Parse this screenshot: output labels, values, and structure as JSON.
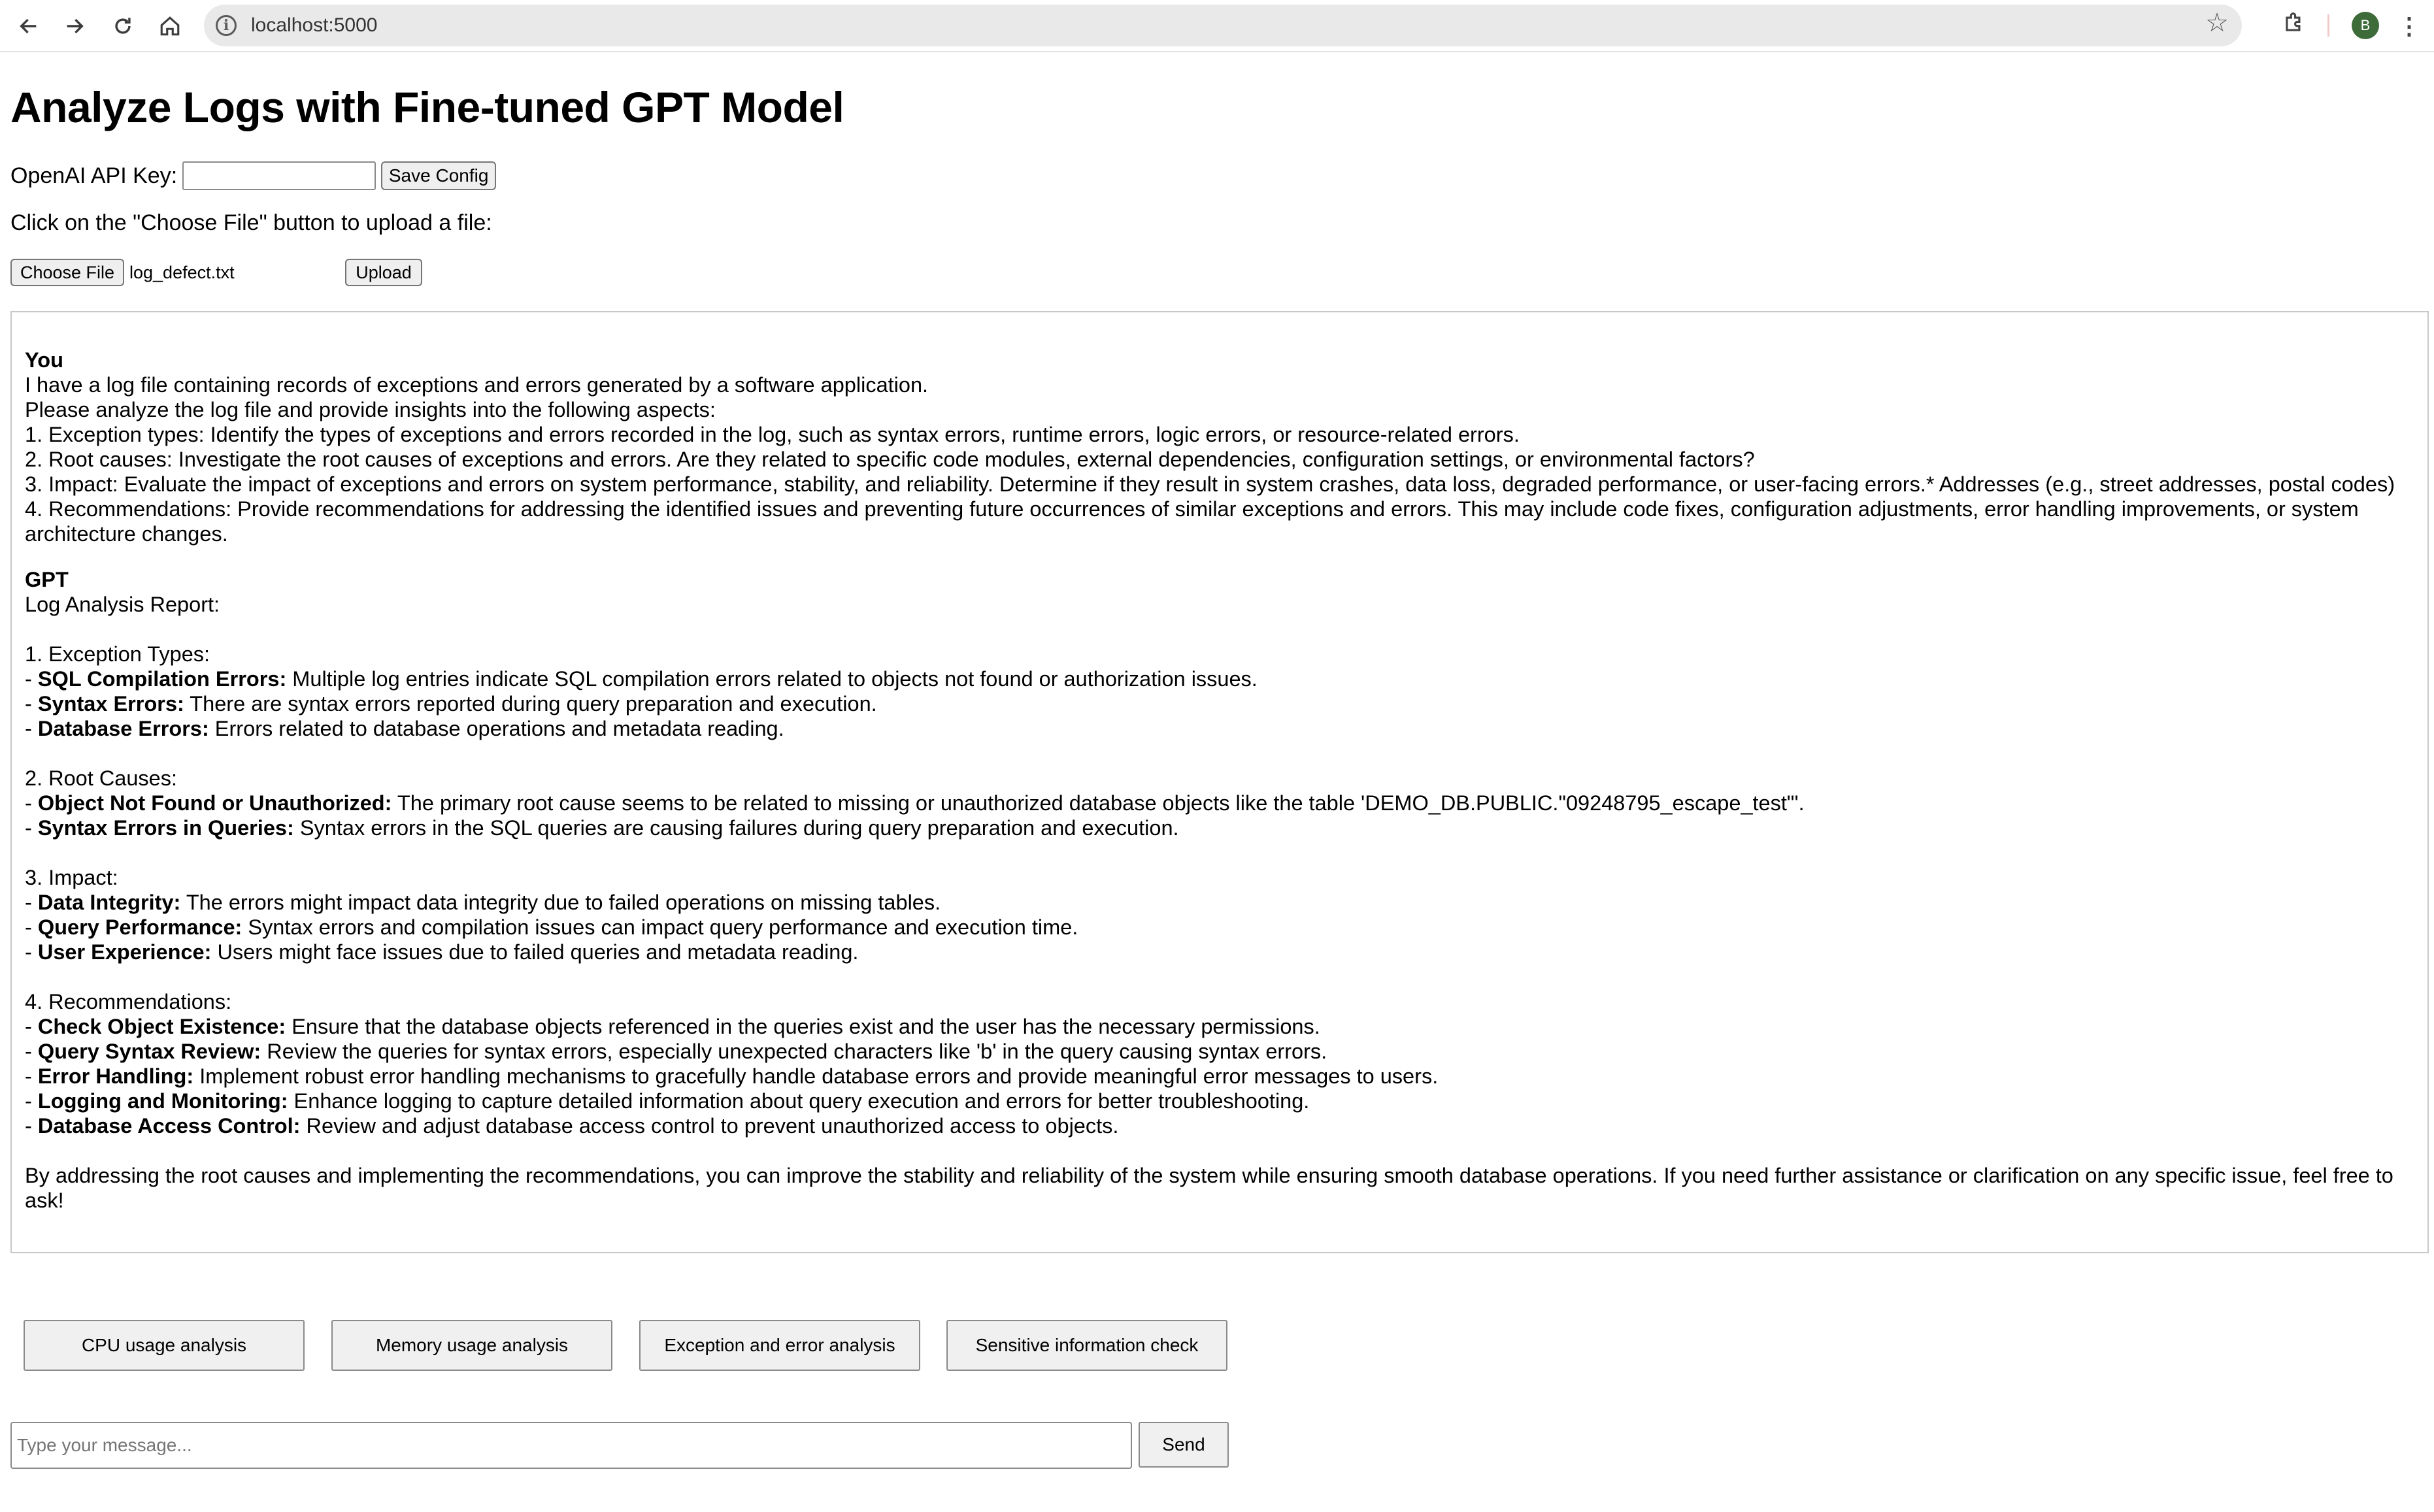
{
  "browser": {
    "url": "localhost:5000",
    "avatar_letter": "B",
    "icons": [
      "back-arrow-icon",
      "forward-arrow-icon",
      "reload-icon",
      "home-icon",
      "site-info-icon",
      "bookmark-star-icon",
      "extensions-puzzle-icon",
      "kebab-menu-icon"
    ]
  },
  "page": {
    "title": "Analyze Logs with Fine-tuned GPT Model",
    "api_key_label": "OpenAI API Key:",
    "api_key_value": "",
    "save_config_label": "Save Config",
    "upload_hint": "Click on the \"Choose File\" button to upload a file:",
    "choose_file_label": "Choose File",
    "file_name": "log_defect.txt",
    "upload_label": "Upload"
  },
  "chat": {
    "user": {
      "sender": "You",
      "lines": [
        "I have a log file containing records of exceptions and errors generated by a software application.",
        "Please analyze the log file and provide insights into the following aspects:",
        "1. Exception types: Identify the types of exceptions and errors recorded in the log, such as syntax errors, runtime errors, logic errors, or resource-related errors.",
        "2. Root causes: Investigate the root causes of exceptions and errors. Are they related to specific code modules, external dependencies, configuration settings, or environmental factors?",
        "3. Impact: Evaluate the impact of exceptions and errors on system performance, stability, and reliability. Determine if they result in system crashes, data loss, degraded performance, or user-facing errors.* Addresses (e.g., street addresses, postal codes)",
        "4. Recommendations: Provide recommendations for addressing the identified issues and preventing future occurrences of similar exceptions and errors. This may include code fixes, configuration adjustments, error handling improvements, or system architecture changes."
      ]
    },
    "gpt": {
      "sender": "GPT",
      "lines": [
        {
          "b": "",
          "t": "Log Analysis Report:"
        },
        {
          "b": "",
          "t": ""
        },
        {
          "b": "",
          "t": "1. Exception Types:"
        },
        {
          "b": "SQL Compilation Errors:",
          "t": " Multiple log entries indicate SQL compilation errors related to objects not found or authorization issues.",
          "p": "- "
        },
        {
          "b": "Syntax Errors:",
          "t": " There are syntax errors reported during query preparation and execution.",
          "p": "- "
        },
        {
          "b": "Database Errors:",
          "t": " Errors related to database operations and metadata reading.",
          "p": "- "
        },
        {
          "b": "",
          "t": ""
        },
        {
          "b": "",
          "t": "2. Root Causes:"
        },
        {
          "b": "Object Not Found or Unauthorized:",
          "t": " The primary root cause seems to be related to missing or unauthorized database objects like the table 'DEMO_DB.PUBLIC.\"09248795_escape_test\"'.",
          "p": "- "
        },
        {
          "b": "Syntax Errors in Queries:",
          "t": " Syntax errors in the SQL queries are causing failures during query preparation and execution.",
          "p": "- "
        },
        {
          "b": "",
          "t": ""
        },
        {
          "b": "",
          "t": "3. Impact:"
        },
        {
          "b": "Data Integrity:",
          "t": " The errors might impact data integrity due to failed operations on missing tables.",
          "p": "- "
        },
        {
          "b": "Query Performance:",
          "t": " Syntax errors and compilation issues can impact query performance and execution time.",
          "p": "- "
        },
        {
          "b": "User Experience:",
          "t": " Users might face issues due to failed queries and metadata reading.",
          "p": "- "
        },
        {
          "b": "",
          "t": ""
        },
        {
          "b": "",
          "t": "4. Recommendations:"
        },
        {
          "b": "Check Object Existence:",
          "t": " Ensure that the database objects referenced in the queries exist and the user has the necessary permissions.",
          "p": "- "
        },
        {
          "b": "Query Syntax Review:",
          "t": " Review the queries for syntax errors, especially unexpected characters like 'b' in the query causing syntax errors.",
          "p": "- "
        },
        {
          "b": "Error Handling:",
          "t": " Implement robust error handling mechanisms to gracefully handle database errors and provide meaningful error messages to users.",
          "p": "- "
        },
        {
          "b": "Logging and Monitoring:",
          "t": " Enhance logging to capture detailed information about query execution and errors for better troubleshooting.",
          "p": "- "
        },
        {
          "b": "Database Access Control:",
          "t": " Review and adjust database access control to prevent unauthorized access to objects.",
          "p": "- "
        },
        {
          "b": "",
          "t": ""
        },
        {
          "b": "",
          "t": "By addressing the root causes and implementing the recommendations, you can improve the stability and reliability of the system while ensuring smooth database operations. If you need further assistance or clarification on any specific issue, feel free to ask!"
        }
      ]
    }
  },
  "quick_actions": [
    "CPU usage analysis",
    "Memory usage analysis",
    "Exception and error analysis",
    "Sensitive information check"
  ],
  "composer": {
    "placeholder": "Type your message...",
    "value": "",
    "send_label": "Send"
  }
}
